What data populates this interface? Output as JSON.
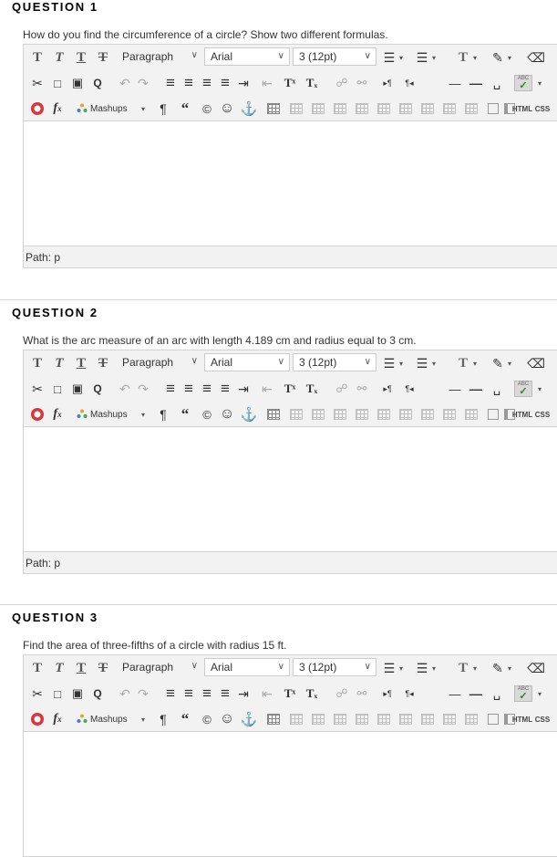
{
  "questions": [
    {
      "title": "QUESTION 1",
      "prompt": "How do you find the circumference of a circle? Show two different formulas.",
      "path_label": "Path: p"
    },
    {
      "title": "QUESTION 2",
      "prompt": "What is the arc measure of an arc with length 4.189 cm and radius equal to 3 cm.",
      "path_label": "Path: p"
    },
    {
      "title": "QUESTION 3",
      "prompt": "Find the area of three-fifths of a circle with radius 15 ft.",
      "path_label": ""
    }
  ],
  "toolbar": {
    "bold": "T",
    "italic": "T",
    "underline": "T",
    "strike": "T",
    "paragraph_style": "Paragraph",
    "font_family": "Arial",
    "font_size": "3 (12pt)",
    "mashups": "Mashups",
    "html_label": "HTML",
    "css_label": "CSS",
    "superscript": "Tˣ",
    "subscript": "Tₓ",
    "spell_label": "ABC",
    "icons": {
      "cut": "✂",
      "copy": "□",
      "paste": "▣",
      "find": "Q",
      "undo": "↶",
      "redo": "↷",
      "align_left": "≡",
      "align_center": "≡",
      "align_right": "≡",
      "justify": "≡",
      "indent": "⇥",
      "outdent": "⇤",
      "link": "☍",
      "unlink": "⚯",
      "ltr": "▸¶",
      "rtl": "¶◂",
      "hr": "—",
      "nbsp": "␣",
      "bullet": "☰",
      "numbered": "☰",
      "text_color": "T",
      "highlight": "✎",
      "eraser": "⌫",
      "pilcrow": "¶",
      "quote": "“",
      "copyright": "©",
      "smiley": "☺",
      "anchor": "⚓",
      "formula": "f",
      "dropdown_caret": "▾",
      "chevron": "∨"
    }
  }
}
